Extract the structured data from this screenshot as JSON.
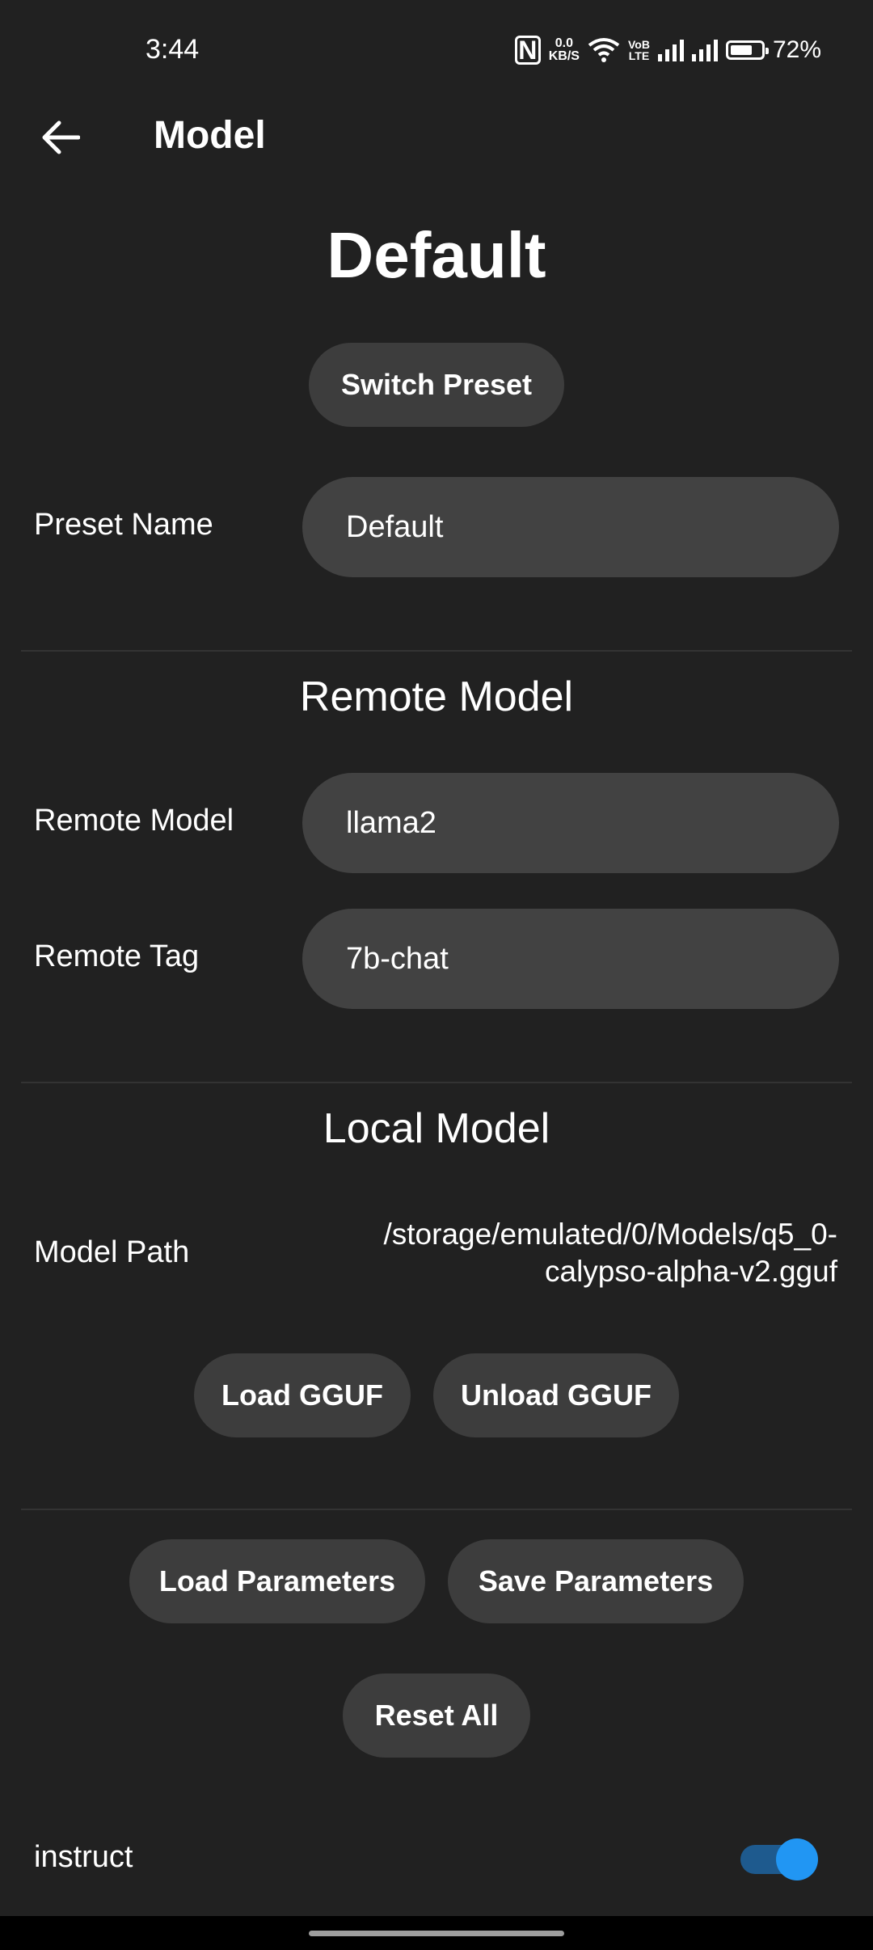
{
  "status_bar": {
    "time": "3:44",
    "nfc": "N",
    "net_speed_value": "0.0",
    "net_speed_unit": "KB/S",
    "volte_top": "VoB",
    "volte_bottom": "LTE",
    "battery_percent": "72%",
    "battery_level": 0.72
  },
  "app_bar": {
    "title": "Model",
    "back_icon": "arrow-left-icon"
  },
  "page_title": "Default",
  "buttons": {
    "switch_preset": "Switch Preset",
    "load_gguf": "Load GGUF",
    "unload_gguf": "Unload GGUF",
    "load_parameters": "Load Parameters",
    "save_parameters": "Save Parameters",
    "reset_all": "Reset All"
  },
  "preset": {
    "label": "Preset Name",
    "value": "Default"
  },
  "remote": {
    "section_title": "Remote Model",
    "model_label": "Remote Model",
    "model_value": "llama2",
    "tag_label": "Remote Tag",
    "tag_value": "7b-chat"
  },
  "local": {
    "section_title": "Local Model",
    "path_label": "Model Path",
    "path_line1": "/storage/emulated/0/Models/q5_0-",
    "path_line2": "calypso-alpha-v2.gguf"
  },
  "instruct": {
    "label": "instruct",
    "enabled": true
  },
  "colors": {
    "background": "#212121",
    "pill": "#3d3d3d",
    "field": "#424242",
    "toggle_thumb": "#2196f3",
    "toggle_track": "#1e5a8e"
  }
}
